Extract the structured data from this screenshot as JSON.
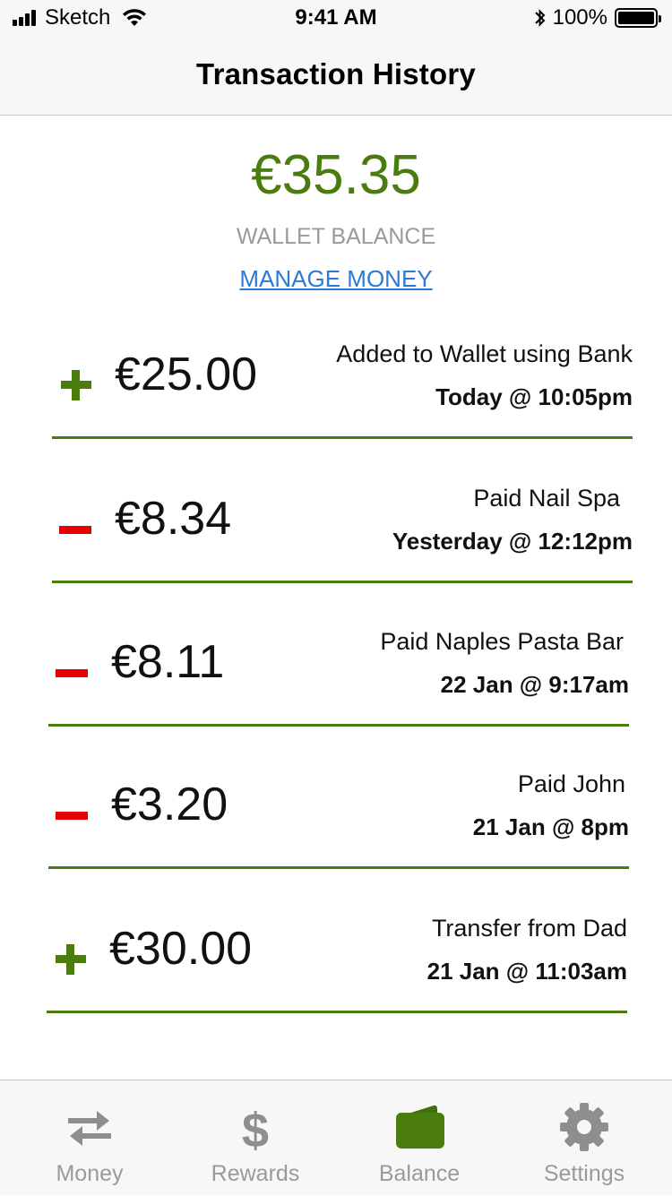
{
  "status_bar": {
    "carrier": "Sketch",
    "time": "9:41 AM",
    "battery": "100%"
  },
  "nav": {
    "title": "Transaction History"
  },
  "wallet": {
    "balance": "€35.35",
    "label": "WALLET BALANCE",
    "manage_link": "MANAGE MONEY"
  },
  "transactions": [
    {
      "type": "credit",
      "amount": "€25.00",
      "description": "Added to Wallet using Bank",
      "when": "Today @ 10:05pm"
    },
    {
      "type": "debit",
      "amount": "€8.34",
      "description": "Paid Nail Spa",
      "when": "Yesterday @ 12:12pm"
    },
    {
      "type": "debit",
      "amount": "€8.11",
      "description": "Paid Naples Pasta Bar",
      "when": "22 Jan @ 9:17am"
    },
    {
      "type": "debit",
      "amount": "€3.20",
      "description": "Paid John",
      "when": "21 Jan @ 8pm"
    },
    {
      "type": "credit",
      "amount": "€30.00",
      "description": "Transfer from Dad",
      "when": "21 Jan @ 11:03am"
    }
  ],
  "tabs": [
    {
      "label": "Money",
      "icon": "transfer-arrows-icon",
      "active": false
    },
    {
      "label": "Rewards",
      "icon": "dollar-icon",
      "active": false
    },
    {
      "label": "Balance",
      "icon": "wallet-icon",
      "active": true
    },
    {
      "label": "Settings",
      "icon": "gear-icon",
      "active": false
    }
  ],
  "colors": {
    "accent_green": "#4a7c0e",
    "debit_red": "#e60000",
    "link_blue": "#2c79d6",
    "muted_gray": "#9a9a9a"
  }
}
